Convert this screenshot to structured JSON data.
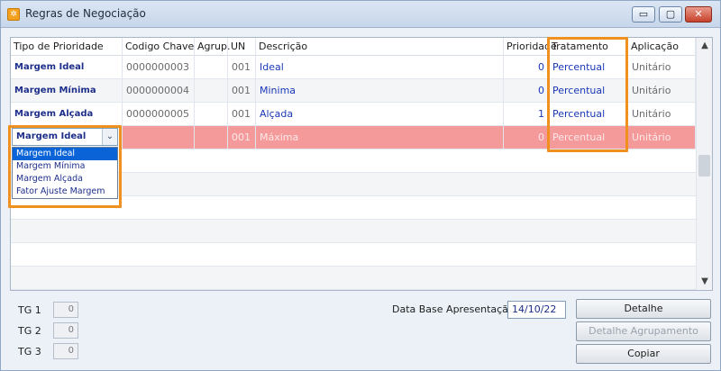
{
  "window": {
    "title": "Regras de Negociação",
    "icon": "app-orange-icon",
    "controls": {
      "minimize": "▭",
      "maximize": "▢",
      "close": "✕"
    }
  },
  "grid": {
    "columns": [
      "Tipo de Prioridade",
      "Codigo Chave",
      "Agrup.",
      "UN",
      "Descrição",
      "Prioridade",
      "Tratamento",
      "Aplicação"
    ],
    "rows": [
      {
        "tipo": "Margem Ideal",
        "codigo": "0000000003",
        "agrup": "",
        "un": "001",
        "descricao": "Ideal",
        "prioridade": "0",
        "tratamento": "Percentual",
        "aplicacao": "Unitário"
      },
      {
        "tipo": "Margem Mínima",
        "codigo": "0000000004",
        "agrup": "",
        "un": "001",
        "descricao": "Minima",
        "prioridade": "0",
        "tratamento": "Percentual",
        "aplicacao": "Unitário"
      },
      {
        "tipo": "Margem Alçada",
        "codigo": "0000000005",
        "agrup": "",
        "un": "001",
        "descricao": "Alçada",
        "prioridade": "1",
        "tratamento": "Percentual",
        "aplicacao": "Unitário"
      },
      {
        "tipo": "",
        "codigo": "",
        "agrup": "",
        "un": "001",
        "descricao": "Máxima",
        "prioridade": "0",
        "tratamento": "Percentual",
        "aplicacao": "Unitário"
      }
    ],
    "editor": {
      "selected": "Margem Ideal",
      "options": [
        "Margem Ideal",
        "Margem Mínima",
        "Margem Alçada",
        "Fator Ajuste Margem"
      ]
    },
    "scroll": {
      "up": "▲",
      "down": "▼"
    }
  },
  "footer": {
    "tg": [
      {
        "label": "TG 1",
        "value": "0"
      },
      {
        "label": "TG 2",
        "value": "0"
      },
      {
        "label": "TG 3",
        "value": "0"
      }
    ],
    "data_base_label": "Data Base Apresentação",
    "data_base_value": "14/10/22",
    "buttons": {
      "detalhe": "Detalhe",
      "detalhe_agrupamento": "Detalhe Agrupamento",
      "copiar": "Copiar"
    }
  },
  "colors": {
    "selected_row": "#f59a9a",
    "highlight": "#f0901e",
    "dropdown_highlight": "#0a64d8"
  }
}
